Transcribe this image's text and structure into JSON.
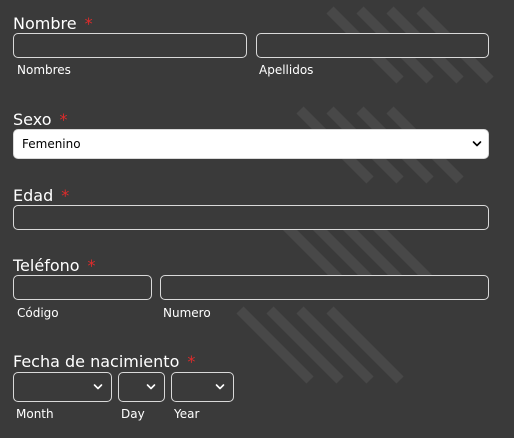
{
  "form": {
    "nombre": {
      "label": "Nombre",
      "required": "*",
      "first_label": "Nombres",
      "last_label": "Apellidos",
      "first_value": "",
      "last_value": ""
    },
    "sexo": {
      "label": "Sexo",
      "required": "*",
      "selected": "Femenino"
    },
    "edad": {
      "label": "Edad",
      "required": "*",
      "value": ""
    },
    "telefono": {
      "label": "Teléfono",
      "required": "*",
      "code_label": "Código",
      "number_label": "Numero",
      "code_value": "",
      "number_value": ""
    },
    "fecha": {
      "label": "Fecha de nacimiento",
      "required": "*",
      "month_label": "Month",
      "day_label": "Day",
      "year_label": "Year",
      "month_value": "",
      "day_value": "",
      "year_value": ""
    }
  },
  "colors": {
    "background": "#3a3a3a",
    "required": "#e02b2b",
    "field_border": "#d9d9d9",
    "select_bg": "#ffffff"
  },
  "icons": {
    "chevron": "chevron-down-icon"
  }
}
